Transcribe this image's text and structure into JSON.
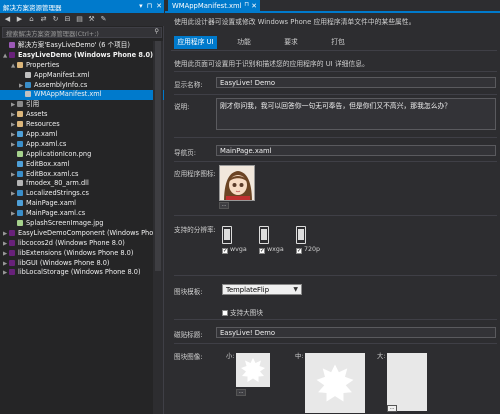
{
  "solution_explorer": {
    "title": "解决方案资源管理器",
    "search_placeholder": "搜索解决方案资源管理器(Ctrl+;)",
    "tree": [
      {
        "label": "解决方案'EasyLiveDemo' (6 个项目)",
        "indent": 0,
        "icon": "sln",
        "arrow": ""
      },
      {
        "label": "EasyLiveDemo (Windows Phone 8.0)",
        "indent": 0,
        "icon": "proj",
        "arrow": "▲",
        "bold": true
      },
      {
        "label": "Properties",
        "indent": 1,
        "icon": "folder",
        "arrow": "▲"
      },
      {
        "label": "AppManifest.xml",
        "indent": 2,
        "icon": "file",
        "arrow": ""
      },
      {
        "label": "AssemblyInfo.cs",
        "indent": 2,
        "icon": "cs",
        "arrow": "▶"
      },
      {
        "label": "WMAppManifest.xml",
        "indent": 2,
        "icon": "file",
        "arrow": "",
        "selected": true
      },
      {
        "label": "引用",
        "indent": 1,
        "icon": "ref",
        "arrow": "▶"
      },
      {
        "label": "Assets",
        "indent": 1,
        "icon": "folder",
        "arrow": "▶"
      },
      {
        "label": "Resources",
        "indent": 1,
        "icon": "folder",
        "arrow": "▶"
      },
      {
        "label": "App.xaml",
        "indent": 1,
        "icon": "xaml",
        "arrow": "▶"
      },
      {
        "label": "App.xaml.cs",
        "indent": 1,
        "icon": "cs",
        "arrow": "▶"
      },
      {
        "label": "ApplicationIcon.png",
        "indent": 1,
        "icon": "img",
        "arrow": ""
      },
      {
        "label": "EditBox.xaml",
        "indent": 1,
        "icon": "xaml",
        "arrow": ""
      },
      {
        "label": "EditBox.xaml.cs",
        "indent": 1,
        "icon": "cs",
        "arrow": "▶"
      },
      {
        "label": "fmodex_80_arm.dll",
        "indent": 1,
        "icon": "dll",
        "arrow": ""
      },
      {
        "label": "LocalizedStrings.cs",
        "indent": 1,
        "icon": "cs",
        "arrow": "▶"
      },
      {
        "label": "MainPage.xaml",
        "indent": 1,
        "icon": "xaml",
        "arrow": ""
      },
      {
        "label": "MainPage.xaml.cs",
        "indent": 1,
        "icon": "cs",
        "arrow": "▶"
      },
      {
        "label": "SplashScreenImage.jpg",
        "indent": 1,
        "icon": "img",
        "arrow": ""
      },
      {
        "label": "EasyLiveDemoComponent (Windows Phone 8.0)",
        "indent": 0,
        "icon": "proj",
        "arrow": "▶"
      },
      {
        "label": "libcocos2d (Windows Phone 8.0)",
        "indent": 0,
        "icon": "proj",
        "arrow": "▶"
      },
      {
        "label": "libExtensions (Windows Phone 8.0)",
        "indent": 0,
        "icon": "proj",
        "arrow": "▶"
      },
      {
        "label": "libGUI (Windows Phone 8.0)",
        "indent": 0,
        "icon": "proj",
        "arrow": "▶"
      },
      {
        "label": "libLocalStorage (Windows Phone 8.0)",
        "indent": 0,
        "icon": "proj",
        "arrow": "▶"
      }
    ]
  },
  "document": {
    "tab_title": "WMAppManifest.xml",
    "description": "使用此设计器可设置或修改 Windows Phone 应用程序清单文件中的某些属性。",
    "tabs": [
      {
        "label": "应用程序 UI",
        "active": true
      },
      {
        "label": "功能",
        "active": false
      },
      {
        "label": "要求",
        "active": false
      },
      {
        "label": "打包",
        "active": false
      }
    ],
    "intro": "使用此页面可设置用于识别和描述您的应用程序的 UI 详细信息。",
    "fields": {
      "display_name_label": "显示名称:",
      "display_name_value": "EasyLive! Demo",
      "description_label": "说明:",
      "description_value": "刚才你问我，我可以回答你一句无可奉告，但是你们又不高兴，那我怎么办？",
      "nav_page_label": "导航页:",
      "nav_page_value": "MainPage.xaml",
      "app_icon_label": "应用程序图标:",
      "browse_label": "...",
      "resolutions_label": "支持的分辨率:",
      "resolutions": [
        {
          "label": "wvga",
          "checked": true
        },
        {
          "label": "wxga",
          "checked": true
        },
        {
          "label": "720p",
          "checked": true
        }
      ],
      "tile_template_label": "图块模板:",
      "tile_template_value": "TemplateFlip",
      "large_tile_label": "支持大图块",
      "large_tile_checked": false,
      "tile_title_label": "磁贴标题:",
      "tile_title_value": "EasyLive! Demo",
      "tile_images_label": "图块图像:",
      "tile_sizes": [
        "小:",
        "中:",
        "大:"
      ]
    }
  },
  "colors": {
    "accent": "#007acc",
    "background": "#2d2d30",
    "panel": "#252526"
  }
}
